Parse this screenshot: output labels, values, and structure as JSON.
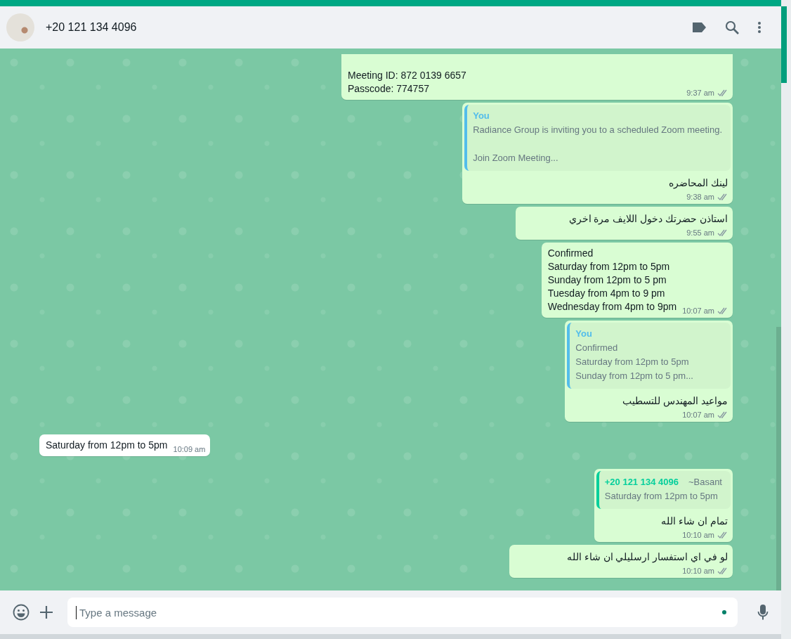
{
  "header": {
    "contact": "+20 121 134 4096"
  },
  "messages": [
    {
      "kind": "outgoing",
      "lines": [
        "Meeting ID: 872 0139 6657",
        "Passcode: 774757"
      ],
      "time": "9:37 am"
    },
    {
      "kind": "outgoing",
      "quote": {
        "author": "You",
        "color": "#53bdeb",
        "paragraphs": [
          [
            "Radiance Group is inviting you to a scheduled Zoom meeting."
          ],
          [
            "Join Zoom Meeting..."
          ]
        ]
      },
      "lines": [
        "لينك المحاضره"
      ],
      "time": "9:38 am"
    },
    {
      "kind": "outgoing",
      "lines": [
        "استاذن حضرتك دخول اللايف مرة اخري"
      ],
      "time": "9:55 am"
    },
    {
      "kind": "outgoing",
      "lines": [
        "Confirmed",
        "Saturday from 12pm to 5pm",
        "Sunday from 12pm to 5 pm",
        "Tuesday from 4pm to 9 pm",
        "Wednesday from 4pm to 9pm"
      ],
      "time": "10:07 am"
    },
    {
      "kind": "outgoing",
      "quote": {
        "author": "You",
        "color": "#53bdeb",
        "paragraphs": [
          [
            "Confirmed",
            "Saturday from 12pm to 5pm",
            "Sunday from 12pm to 5 pm..."
          ]
        ]
      },
      "lines": [
        "مواعيد المهندس للتسطيب"
      ],
      "time": "10:07 am"
    },
    {
      "kind": "incoming",
      "lines": [
        "Saturday from 12pm to 5pm"
      ],
      "time": "10:09 am"
    },
    {
      "kind": "outgoing",
      "quote": {
        "author": "+20 121 134 4096",
        "alias": "~Basant",
        "color": "#06cf9c",
        "paragraphs": [
          [
            "Saturday from 12pm to 5pm"
          ]
        ]
      },
      "lines": [
        "تمام ان شاء الله"
      ],
      "time": "10:10 am"
    },
    {
      "kind": "outgoing",
      "lines": [
        "لو في اي استفسار ارسليلي ان شاء الله"
      ],
      "time": "10:10 am"
    }
  ],
  "composer": {
    "placeholder": "Type a message"
  }
}
